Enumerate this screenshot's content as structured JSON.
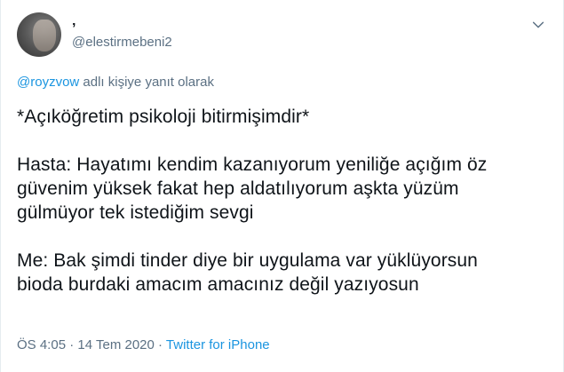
{
  "tweet": {
    "display_name": "‚",
    "username": "@elestirmebeni2",
    "reply_context": {
      "mention": "@royzvow",
      "suffix": " adlı kişiye yanıt olarak"
    },
    "lines": [
      "*Açıköğretim psikoloji bitirmişimdir*",
      "",
      "Hasta: Hayatımı kendim kazanıyorum yeniliğe açığım öz",
      "güvenim yüksek fakat hep aldatılıyorum aşkta yüzüm",
      "gülmüyor tek istediğim sevgi",
      "",
      "Me: Bak şimdi tinder diye bir uygulama var yüklüyorsun",
      "bioda burdaki amacım amacınız değil yazıyosun"
    ],
    "time": "ÖS 4:05",
    "separator": " · ",
    "date": "14 Tem 2020",
    "source": "Twitter for iPhone"
  },
  "icons": {
    "menu": "chevron-down-icon"
  },
  "colors": {
    "link": "#1b95e0",
    "secondary_text": "#5b7083",
    "primary_text": "#0f1419"
  }
}
